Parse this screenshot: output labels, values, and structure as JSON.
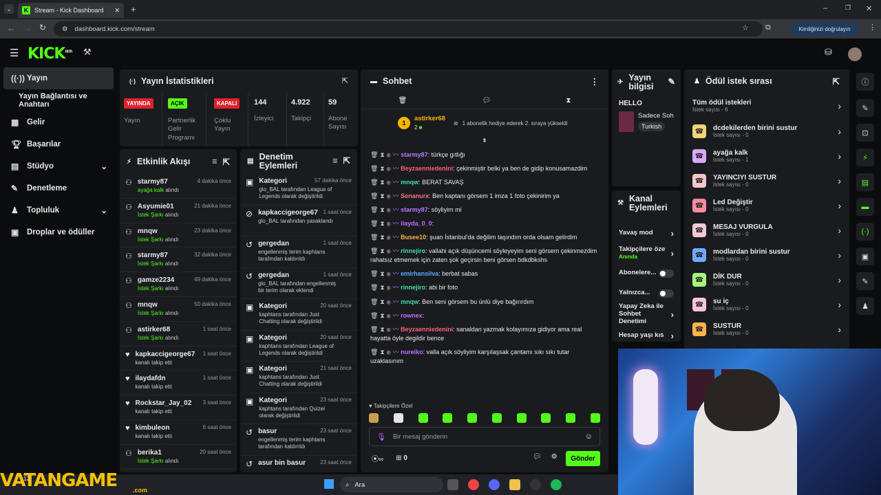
{
  "browser": {
    "tab_title": "Stream - Kick Dashboard",
    "url": "dashboard.kick.com/stream",
    "verify": "Kimliğinizi doğrulayın"
  },
  "nav": {
    "items": [
      {
        "label": "Yayın",
        "icon": "broadcast-icon"
      },
      {
        "label": "Yayın Bağlantısı ve Anahtarı",
        "icon": ""
      },
      {
        "label": "Gelir",
        "icon": "revenue-icon"
      },
      {
        "label": "Başarılar",
        "icon": "trophy-icon"
      },
      {
        "label": "Stüdyo",
        "icon": "studio-icon"
      },
      {
        "label": "Denetleme",
        "icon": "wrench-icon"
      },
      {
        "label": "Topluluk",
        "icon": "community-icon"
      },
      {
        "label": "Droplar ve ödüller",
        "icon": "gift-icon"
      }
    ]
  },
  "stats": {
    "title": "Yayın İstatistikleri",
    "live_badge": "YAYINDA",
    "live_label": "Yayın",
    "open_badge": "AÇIK",
    "open_label": "Partnerlik Gelir Programı",
    "closed_badge": "KAPALI",
    "closed_label": "Çoklu Yayın",
    "viewers": "144",
    "viewers_label": "İzleyici",
    "followers": "4.922",
    "followers_label": "Takipçi",
    "subs": "59",
    "subs_label": "Abone Sayısı"
  },
  "events": {
    "title": "Etkinlik Akışı",
    "rows": [
      {
        "name": "starmy87",
        "sub": "ayağa kalk",
        "sub2": " alındı",
        "time": "4 dakika önce",
        "kind": "reward"
      },
      {
        "name": "Asyumie01",
        "sub": "İstek Şarkı",
        "sub2": " alındı",
        "time": "21 dakika önce",
        "kind": "reward"
      },
      {
        "name": "mnqw",
        "sub": "İstek Şarkı",
        "sub2": " alındı",
        "time": "23 dakika önce",
        "kind": "reward"
      },
      {
        "name": "starmy87",
        "sub": "İstek Şarkı",
        "sub2": " alındı",
        "time": "32 dakika önce",
        "kind": "reward"
      },
      {
        "name": "gamze2234",
        "sub": "İstek Şarkı",
        "sub2": " alındı",
        "time": "49 dakika önce",
        "kind": "reward"
      },
      {
        "name": "mnqw",
        "sub": "İstek Şarkı",
        "sub2": " alındı",
        "time": "50 dakika önce",
        "kind": "reward"
      },
      {
        "name": "astirker68",
        "sub": "İstek Şarkı",
        "sub2": " alındı",
        "time": "1 saat önce",
        "kind": "reward"
      },
      {
        "name": "kapkaccigeorge67",
        "sub": "",
        "sub2": "kanalı takip etti",
        "time": "1 saat önce",
        "kind": "follow"
      },
      {
        "name": "ilaydafdn",
        "sub": "",
        "sub2": "kanalı takip etti",
        "time": "1 saat önce",
        "kind": "follow"
      },
      {
        "name": "Rockstar_Jay_02",
        "sub": "",
        "sub2": "kanalı takip etti",
        "time": "3 saat önce",
        "kind": "follow"
      },
      {
        "name": "kimbuleon",
        "sub": "",
        "sub2": "kanalı takip etti",
        "time": "6 saat önce",
        "kind": "follow"
      },
      {
        "name": "berika1",
        "sub": "İstek Şarkı",
        "sub2": " alındı",
        "time": "20 saat önce",
        "kind": "reward"
      }
    ]
  },
  "mod": {
    "title_1": "Denetim",
    "title_2": "Eylemleri",
    "rows": [
      {
        "name": "Kategori",
        "time": "57 dakika önce",
        "line1": "glo_BAL tarafından League of",
        "line2": "Legends olarak değiştirildi",
        "icon": "category-icon"
      },
      {
        "name": "kapkaccigeorge67",
        "time": "1 saat önce",
        "line1": "glo_BAL tarafından yasaklandı",
        "line2": "",
        "icon": "ban-icon"
      },
      {
        "name": "gergedan",
        "time": "1 saat önce",
        "line1": "engellenmiş terim kaphtans",
        "line2": "tarafından kaldırıldı",
        "icon": "undo-icon"
      },
      {
        "name": "gergedan",
        "time": "1 saat önce",
        "line1": "glo_BAL tarafından engellenmiş",
        "line2": "bir terim olarak eklendi",
        "icon": "undo-icon"
      },
      {
        "name": "Kategori",
        "time": "20 saat önce",
        "line1": "kaphtans tarafından Just",
        "line2": "Chatting olarak değiştirildi",
        "icon": "category-icon"
      },
      {
        "name": "Kategori",
        "time": "20 saat önce",
        "line1": "kaphtans tarafından League of",
        "line2": "Legends olarak değiştirildi",
        "icon": "category-icon"
      },
      {
        "name": "Kategori",
        "time": "21 saat önce",
        "line1": "kaphtans tarafından Just",
        "line2": "Chatting olarak değiştirildi",
        "icon": "category-icon"
      },
      {
        "name": "Kategori",
        "time": "23 saat önce",
        "line1": "kaphtans tarafından Quizei",
        "line2": "olarak değiştirildi",
        "icon": "category-icon"
      },
      {
        "name": "basur",
        "time": "23 saat önce",
        "line1": "engellenmiş terim kaphtans",
        "line2": "tarafından kaldırıldı",
        "icon": "undo-icon"
      },
      {
        "name": "asur bin basur",
        "time": "23 saat önce",
        "line1": "",
        "line2": "",
        "icon": "undo-icon"
      }
    ]
  },
  "chat": {
    "title": "Sohbet",
    "pinned_user": "astirker68",
    "pinned_count": "2",
    "pinned_text": "1 abonelik hediye ederek 2. sıraya yükseldi",
    "messages": [
      {
        "user": "starmy87",
        "color": "#b77bff",
        "text": ": türkçe gıtlığı"
      },
      {
        "user": "Beyzaenniedenini",
        "color": "#ff5f7a",
        "text": ": çekinmiştir belki ya ben de gidip konusamazdim"
      },
      {
        "user": "mnqw",
        "color": "#3ee0a4",
        "text": ": BERAT SAVAŞ"
      },
      {
        "user": "Senanurx",
        "color": "#ff6f8a",
        "text": ": Ben kaptanı görsem 1 imza 1 foto çekinirim ya"
      },
      {
        "user": "starmy87",
        "color": "#b77bff",
        "text": ": söyliyim mi"
      },
      {
        "user": "ilayda_0_0",
        "color": "#c26dff",
        "text": ":"
      },
      {
        "user": "Busee10",
        "color": "#ffb347",
        "text": ": şuan İstanbul'da değilim taşındım orda olsam gelirdim"
      },
      {
        "user": "rinnejiro",
        "color": "#3ee0a4",
        "text": ": vallahi açık düşüncemi söyleyeyim seni görsem çekinmezdim rahatsız etmemek için zaten şok geçirsin beni görsen bdkdbkshs"
      },
      {
        "user": "emirhansilva",
        "color": "#5aa9ff",
        "text": ": berbat sabas"
      },
      {
        "user": "rinnejiro",
        "color": "#3ee0a4",
        "text": ": abi bir foto"
      },
      {
        "user": "mnqw",
        "color": "#3ee0a4",
        "text": ": Ben seni görsem bu ünlü diye bağırırdım"
      },
      {
        "user": "rownex",
        "color": "#c26dff",
        "text": ":"
      },
      {
        "user": "Beyzaenniedenini",
        "color": "#ff5f7a",
        "text": ": sanaldan yazmak kolayımıza gidiyor ama real hayatta öyle degildir bence"
      },
      {
        "user": "nureiko",
        "color": "#c26dff",
        "text": ": valla açık söyliyim karşılaşsak çantamı sıkı sıkı tutar uzaklasınım"
      }
    ],
    "emote_label": "Takipçilere Özel",
    "placeholder": "Bir mesaj gönderin",
    "send": "Gönder",
    "points": "0"
  },
  "info": {
    "title_1": "Yayın",
    "title_2": "bilgisi",
    "stream_title": "HELLO",
    "category": "Sadece Soh",
    "language": "Turkish"
  },
  "channel": {
    "title_1": "Kanal",
    "title_2": "Eylemleri",
    "items": [
      {
        "label": "Yavaş mod",
        "sub": ""
      },
      {
        "label": "Takipçilere öze",
        "sub": "Anında"
      },
      {
        "label": "Abonelere...",
        "sub": ""
      },
      {
        "label": "Yalnızca...",
        "sub": ""
      },
      {
        "label": "Yapay Zeka ile Sohbet Denetimi",
        "sub": ""
      },
      {
        "label": "Hesap yaşı kıs",
        "sub": ""
      }
    ]
  },
  "rewards": {
    "title": "Ödül istek sırası",
    "all_label": "Tüm ödül istekleri",
    "all_count": "İstek sayısı - 6",
    "items": [
      {
        "label": "dcdekilerden birini sustur",
        "count": "İstek sayısı - 0",
        "color": "#f5d37a"
      },
      {
        "label": "ayağa kalk",
        "count": "İstek sayısı - 1",
        "color": "#d9a8ff"
      },
      {
        "label": "YAYINCIYI SUSTUR",
        "count": "İstek sayısı - 0",
        "color": "#f4c6c6"
      },
      {
        "label": "Led Değiştir",
        "count": "İstek sayısı - 0",
        "color": "#ff8aa0"
      },
      {
        "label": "MESAJ VURGULA",
        "count": "İstek sayısı - 0",
        "color": "#f3c9d6"
      },
      {
        "label": "modlardan birini sustur",
        "count": "İstek sayısı - 0",
        "color": "#6fa8ff"
      },
      {
        "label": "DİK DUR",
        "count": "İstek sayısı - 0",
        "color": "#a6f57a"
      },
      {
        "label": "su iç",
        "count": "İstek sayısı - 0",
        "color": "#f4c6d6"
      },
      {
        "label": "SUSTUR",
        "count": "İstek sayısı - 0",
        "color": "#ffb347"
      }
    ]
  },
  "taskbar": {
    "search": "Ara",
    "watermark": "VATANGAME",
    "watermark_sub": ".com",
    "weather": "12"
  }
}
